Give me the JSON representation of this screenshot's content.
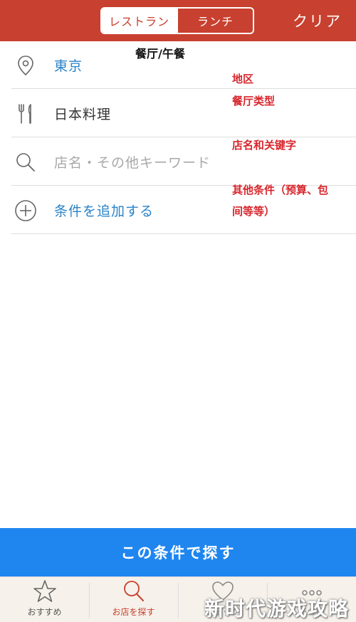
{
  "header": {
    "segment_tabs": [
      {
        "label": "レストラン",
        "active": true
      },
      {
        "label": "ランチ",
        "active": false
      }
    ],
    "clear_label": "クリア"
  },
  "annotations": {
    "top": "餐厅/午餐",
    "area": "地区",
    "cuisine": "餐厅类型",
    "keyword": "店名和关键字",
    "other_line1": "其他条件（预算、包",
    "other_line2": "间等等）"
  },
  "rows": {
    "area": {
      "value": "東京",
      "icon": "location-pin-icon"
    },
    "cuisine": {
      "value": "日本料理",
      "icon": "fork-knife-icon"
    },
    "keyword": {
      "placeholder": "店名・その他キーワード",
      "icon": "search-icon"
    },
    "add_condition": {
      "label": "条件を追加する",
      "icon": "plus-circle-icon"
    }
  },
  "search_button": {
    "label": "この条件で探す"
  },
  "tabbar": {
    "items": [
      {
        "label": "おすすめ",
        "icon": "star-icon",
        "active": false
      },
      {
        "label": "お店を探す",
        "icon": "search-icon",
        "active": true
      },
      {
        "label": "チェック",
        "icon": "heart-icon",
        "active": false
      },
      {
        "label": "その他",
        "icon": "more-icon",
        "active": false
      }
    ]
  },
  "watermark": "新时代游戏攻略",
  "colors": {
    "header_red": "#c8402f",
    "link_blue": "#2a83c9",
    "button_blue": "#1f86ef",
    "annotation_red": "#d8262d"
  }
}
